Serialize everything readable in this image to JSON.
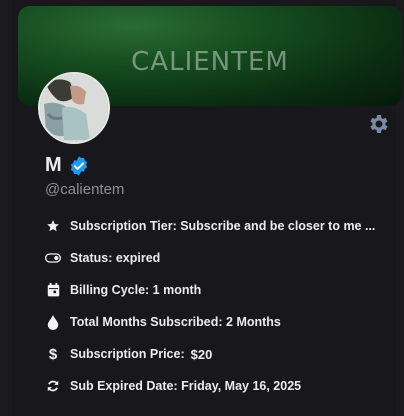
{
  "banner": {
    "title": "CALIENTEM"
  },
  "profile": {
    "name": "M",
    "handle": "@calientem"
  },
  "details": {
    "tier": "Subscription Tier: Subscribe and be closer to me ...",
    "status": "Status: expired",
    "billing": "Billing Cycle: 1 month",
    "months": "Total Months Subscribed: 2 Months",
    "price_label": "Subscription Price:",
    "price_value": "$20",
    "expired": "Sub Expired Date: Friday, May 16, 2025"
  },
  "icons": {
    "settings": "gear-icon",
    "verified": "verified-badge-icon",
    "tier": "star-icon",
    "status": "toggle-icon",
    "billing": "calendar-icon",
    "months": "drop-icon",
    "price": "dollar-icon",
    "expired": "refresh-icon"
  },
  "colors": {
    "background": "#18181c",
    "accent_blue": "#1d9bf0",
    "banner_green": "#154d1f"
  }
}
